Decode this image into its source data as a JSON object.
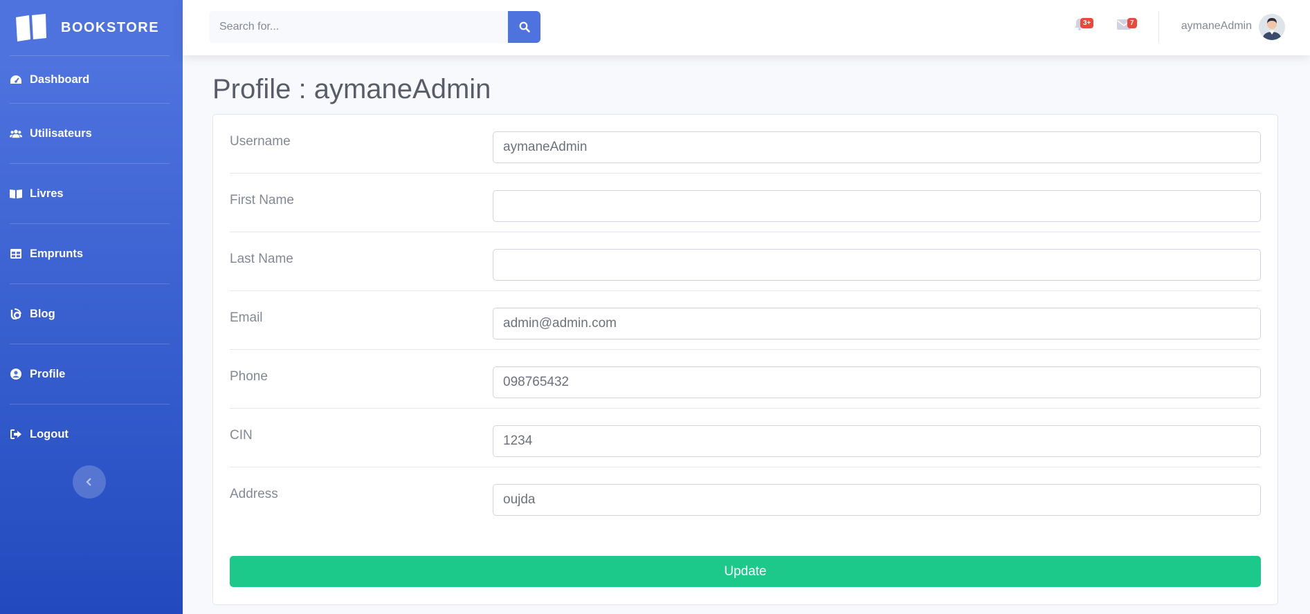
{
  "brand": {
    "name": "BOOKSTORE",
    "icon": "book-open-icon"
  },
  "sidebar": {
    "items": [
      {
        "label": "Dashboard",
        "icon": "tachometer-icon"
      },
      {
        "label": "Utilisateurs",
        "icon": "users-icon"
      },
      {
        "label": "Livres",
        "icon": "book-icon"
      },
      {
        "label": "Emprunts",
        "icon": "table-icon"
      },
      {
        "label": "Blog",
        "icon": "blog-icon"
      },
      {
        "label": "Profile",
        "icon": "user-circle-icon"
      },
      {
        "label": "Logout",
        "icon": "sign-out-icon"
      }
    ],
    "toggle_icon": "chevron-left-icon"
  },
  "topbar": {
    "search_placeholder": "Search for...",
    "alerts_badge": "3+",
    "messages_badge": "7",
    "user_name": "aymaneAdmin"
  },
  "page": {
    "title": "Profile : aymaneAdmin"
  },
  "form": {
    "fields": [
      {
        "label": "Username",
        "value": "aymaneAdmin"
      },
      {
        "label": "First Name",
        "value": ""
      },
      {
        "label": "Last Name",
        "value": ""
      },
      {
        "label": "Email",
        "value": "admin@admin.com"
      },
      {
        "label": "Phone",
        "value": "098765432"
      },
      {
        "label": "CIN",
        "value": "1234"
      },
      {
        "label": "Address",
        "value": "oujda"
      }
    ],
    "submit_label": "Update"
  },
  "colors": {
    "primary": "#4e73df",
    "success": "#1cc88a",
    "danger": "#e74a3b"
  }
}
